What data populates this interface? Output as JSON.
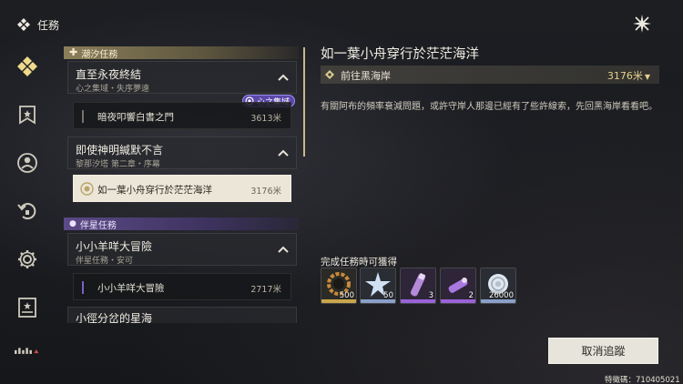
{
  "header": {
    "title": "任務",
    "close_icon": "close-sparkle-icon"
  },
  "nav": {
    "items": [
      {
        "icon": "quest-diamond-icon",
        "active": true
      },
      {
        "icon": "bookmark-star-icon",
        "active": false
      },
      {
        "icon": "profile-icon",
        "active": false
      },
      {
        "icon": "return-arrow-icon",
        "active": false
      },
      {
        "icon": "gear-icon",
        "active": false
      },
      {
        "icon": "card-star-icon",
        "active": false
      },
      {
        "icon": "signal-bars-icon",
        "active": false
      }
    ]
  },
  "categories": {
    "tide": {
      "label": "潮汐任務",
      "icon": "plus-icon"
    },
    "companion": {
      "label": "伴星任務",
      "icon": "person-icon"
    }
  },
  "groups": [
    {
      "title": "直至永夜終結",
      "subtitle": "心之集域・失序夢遠",
      "badge": "心之集域",
      "tasks": [
        {
          "name": "暗夜叩響白書之門",
          "distance": "3613米"
        }
      ]
    },
    {
      "title": "即使神明緘默不言",
      "subtitle": "黎那汐塔 第二章・序幕",
      "tasks": [
        {
          "name": "如一葉小舟穿行於茫茫海洋",
          "distance": "3176米",
          "selected": true
        }
      ]
    },
    {
      "title": "小小羊咩大冒險",
      "subtitle": "伴星任務・安可",
      "tasks": [
        {
          "name": "小小羊咩大冒險",
          "distance": "2717米"
        }
      ]
    },
    {
      "title": "小徑分岔的星海",
      "subtitle": "",
      "tasks": []
    }
  ],
  "detail": {
    "title": "如一葉小舟穿行於茫茫海洋",
    "objective": "前往黑海岸",
    "distance": "3176米",
    "description": "有關阿布的頻率衰減問題，或許守岸人那邊已經有了些許線索，先回黑海岸看看吧。",
    "reward_label": "完成任務時可獲得",
    "rewards": [
      {
        "icon": "gear-ring-icon",
        "count": "500",
        "rarity_color": "#c9a64a"
      },
      {
        "icon": "crystal-star-icon",
        "count": "50",
        "rarity_color": "#8aa0c8"
      },
      {
        "icon": "potion-tube-icon",
        "count": "3",
        "rarity_color": "#9a62d8"
      },
      {
        "icon": "energy-vial-icon",
        "count": "2",
        "rarity_color": "#9a62d8"
      },
      {
        "icon": "shell-coin-icon",
        "count": "26000",
        "rarity_color": "#8aa0c8"
      }
    ],
    "cancel_label": "取消追蹤"
  },
  "footer": {
    "uid": "特徵碼：710405021"
  },
  "colors": {
    "accent_gold": "#c9b88a",
    "accent_purple": "#5b48a8",
    "selected_bg": "#ebe6d8"
  }
}
